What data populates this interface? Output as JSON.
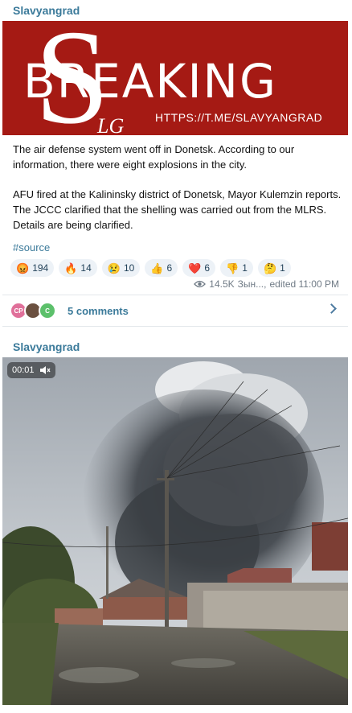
{
  "post1": {
    "channel": "Slavyangrad",
    "banner": {
      "word": "BREAKING",
      "logo_letters": "LG",
      "url": "HTTPS://T.ME/SLAVYANGRAD"
    },
    "paragraphs": [
      "The air defense system went off in Donetsk. According to our information, there were eight explosions in the city.",
      "AFU fired at the Kalininsky district of Donetsk, Mayor Kulemzin reports. The JCCC clarified that the shelling was carried out from the MLRS. Details are being clarified."
    ],
    "hashtag": "#source",
    "reactions": [
      {
        "emoji": "😡",
        "count": "194"
      },
      {
        "emoji": "🔥",
        "count": "14"
      },
      {
        "emoji": "😢",
        "count": "10"
      },
      {
        "emoji": "👍",
        "count": "6"
      },
      {
        "emoji": "❤️",
        "count": "6"
      },
      {
        "emoji": "👎",
        "count": "1"
      },
      {
        "emoji": "🤔",
        "count": "1"
      }
    ],
    "views": "14.5K",
    "author": "Зын...,",
    "edited": "edited 11:00 PM",
    "comments": {
      "label": "5 comments",
      "avatars": [
        {
          "initials": "CP",
          "color": "#e0709a"
        },
        {
          "initials": "",
          "color": "#6b5040"
        },
        {
          "initials": "C",
          "color": "#5cc06b"
        }
      ]
    }
  },
  "post2": {
    "channel": "Slavyangrad",
    "video": {
      "timer": "00:01"
    }
  }
}
